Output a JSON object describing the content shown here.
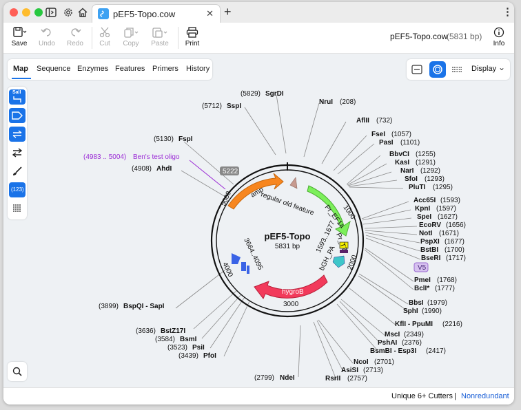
{
  "window": {
    "tab_title": "pEF5-Topo.cow",
    "file_name": "pEF5-Topo.cow",
    "file_size": "(5831 bp)"
  },
  "toolbar": {
    "save": "Save",
    "undo": "Undo",
    "redo": "Redo",
    "cut": "Cut",
    "copy": "Copy",
    "paste": "Paste",
    "print": "Print",
    "info": "Info"
  },
  "view_tabs": [
    "Map",
    "Sequence",
    "Enzymes",
    "Features",
    "Primers",
    "History"
  ],
  "side_buttons": {
    "sall": "SalI",
    "counter": "(123)"
  },
  "display": {
    "label": "Display"
  },
  "map": {
    "name": "pEF5-Topo",
    "length": "5831 bp",
    "ticks": [
      "1000",
      "2000",
      "3000",
      "4000",
      "5000"
    ],
    "feature_labels": {
      "amp": "amp",
      "regular": "regular old feature",
      "pr_ef1a": "Pr_EF1a",
      "pr_t7": "Pr_T7",
      "bgh": "bGH_PA",
      "hygrob": "hygroB",
      "range1": "1593..1677",
      "range2": "3664..4095",
      "v5": "V5",
      "marker": "5222"
    },
    "oligo": {
      "pos": "(4983 .. 5004)",
      "name": "Ben's test oligo"
    },
    "sites": {
      "sgrdi": {
        "pos": "(5829)",
        "name": "SgrDI"
      },
      "sspi": {
        "pos": "(5712)",
        "name": "SspI"
      },
      "nrui": {
        "name": "NruI",
        "pos": "(208)"
      },
      "aflii": {
        "name": "AflII",
        "pos": "(732)"
      },
      "fsei": {
        "name": "FseI",
        "pos": "(1057)"
      },
      "pasi": {
        "name": "PasI",
        "pos": "(1101)"
      },
      "bbvci": {
        "name": "BbvCI",
        "pos": "(1255)"
      },
      "kasi": {
        "name": "KasI",
        "pos": "(1291)"
      },
      "nari": {
        "name": "NarI",
        "pos": "(1292)"
      },
      "sfoi": {
        "name": "SfoI",
        "pos": "(1293)"
      },
      "plut": {
        "name": "PluTI",
        "pos": "(1295)"
      },
      "acc65i": {
        "name": "Acc65I",
        "pos": "(1593)"
      },
      "kpni": {
        "name": "KpnI",
        "pos": "(1597)"
      },
      "spei": {
        "name": "SpeI",
        "pos": "(1627)"
      },
      "ecorv": {
        "name": "EcoRV",
        "pos": "(1656)"
      },
      "noti": {
        "name": "NotI",
        "pos": "(1671)"
      },
      "pspxi": {
        "name": "PspXI",
        "pos": "(1677)"
      },
      "bstbi": {
        "name": "BstBI",
        "pos": "(1700)"
      },
      "bseri": {
        "name": "BseRI",
        "pos": "(1717)"
      },
      "pmei": {
        "name": "PmeI",
        "pos": "(1768)"
      },
      "bcli": {
        "name": "BclI*",
        "pos": "(1777)"
      },
      "bbsi": {
        "name": "BbsI",
        "pos": "(1979)"
      },
      "sphi": {
        "name": "SphI",
        "pos": "(1990)"
      },
      "kfli": {
        "name": "KflI - PpuMI",
        "pos": "(2216)"
      },
      "msci": {
        "name": "MscI",
        "pos": "(2349)"
      },
      "pshai": {
        "name": "PshAI",
        "pos": "(2376)"
      },
      "bsmbi": {
        "name": "BsmBI - Esp3I",
        "pos": "(2417)"
      },
      "ncoi": {
        "name": "NcoI",
        "pos": "(2701)"
      },
      "asisi": {
        "name": "AsiSI",
        "pos": "(2713)"
      },
      "rsrii": {
        "name": "RsrII",
        "pos": "(2757)"
      },
      "ndei": {
        "pos": "(2799)",
        "name": "NdeI"
      },
      "fspi": {
        "pos": "(5130)",
        "name": "FspI"
      },
      "ahdi": {
        "pos": "(4908)",
        "name": "AhdI"
      },
      "bspqi": {
        "pos": "(3899)",
        "name": "BspQI - SapI"
      },
      "bstz17i": {
        "pos": "(3636)",
        "name": "BstZ17I"
      },
      "bsmi": {
        "pos": "(3584)",
        "name": "BsmI"
      },
      "psii": {
        "pos": "(3523)",
        "name": "PsiI"
      },
      "pfoi": {
        "pos": "(3439)",
        "name": "PfoI"
      }
    }
  },
  "status": {
    "cutters": "Unique 6+ Cutters",
    "sep": "|",
    "mode": "Nonredundant"
  }
}
